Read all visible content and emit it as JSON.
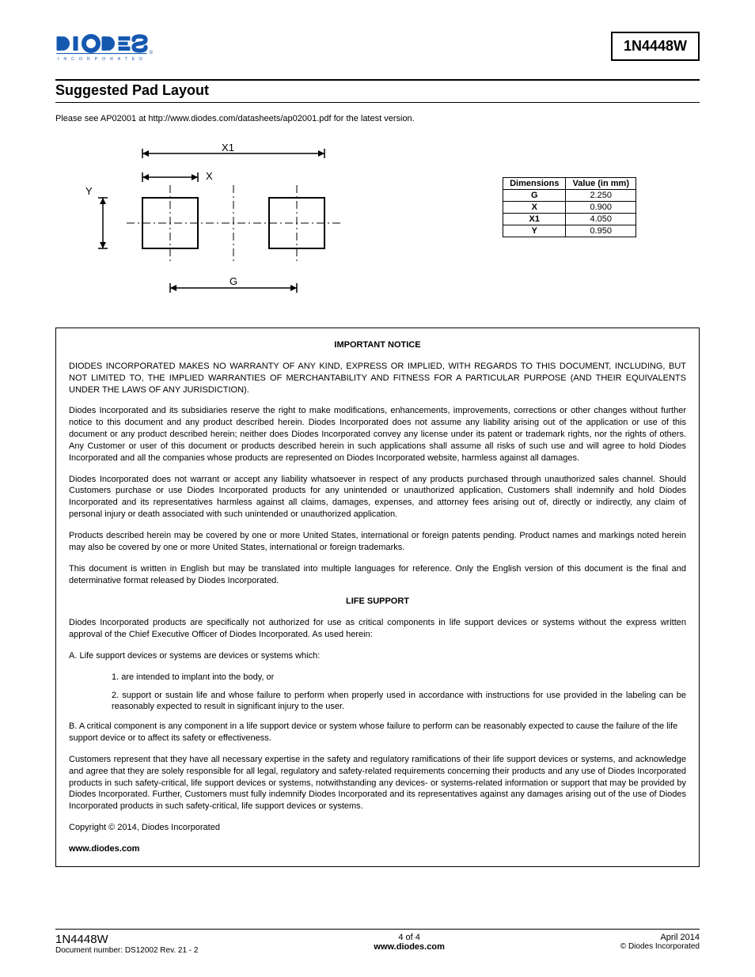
{
  "header": {
    "company": "DIODES",
    "company_sub": "I N C O R P O R A T E D",
    "part_number": "1N4448W"
  },
  "section_title": "Suggested Pad Layout",
  "intro": "Please see AP02001 at http://www.diodes.com/datasheets/ap02001.pdf for the latest version.",
  "diagram_labels": {
    "x1": "X1",
    "x": "X",
    "y": "Y",
    "g": "G"
  },
  "dim_table": {
    "head_dim": "Dimensions",
    "head_val": "Value (in mm)",
    "rows": [
      {
        "dim": "G",
        "val": "2.250"
      },
      {
        "dim": "X",
        "val": "0.900"
      },
      {
        "dim": "X1",
        "val": "4.050"
      },
      {
        "dim": "Y",
        "val": "0.950"
      }
    ]
  },
  "notice": {
    "title": "IMPORTANT NOTICE",
    "p1": "DIODES INCORPORATED MAKES NO WARRANTY OF ANY KIND, EXPRESS OR IMPLIED, WITH REGARDS TO THIS DOCUMENT, INCLUDING, BUT NOT LIMITED TO, THE IMPLIED WARRANTIES OF MERCHANTABILITY AND FITNESS FOR A PARTICULAR PURPOSE (AND THEIR EQUIVALENTS UNDER THE LAWS OF ANY JURISDICTION).",
    "p2": "Diodes Incorporated and its subsidiaries reserve the right to make modifications, enhancements, improvements, corrections or other changes without further notice to this document and any product described herein. Diodes Incorporated does not assume any liability arising out of the application or use of this document or any product described herein; neither does Diodes Incorporated convey any license under its patent or trademark rights, nor the rights of others.  Any Customer or user of this document or products described herein in such applications shall assume all risks of such use and will agree to hold Diodes Incorporated and all the companies whose products are represented on Diodes Incorporated website, harmless against all damages.",
    "p3": "Diodes Incorporated does not warrant or accept any liability whatsoever in respect of any products purchased through unauthorized sales channel. Should Customers purchase or use Diodes Incorporated products for any unintended or unauthorized application, Customers shall indemnify and hold Diodes Incorporated and its representatives harmless against all claims, damages, expenses, and attorney fees arising out of, directly or indirectly, any claim of personal injury or death associated with such unintended or unauthorized application.",
    "p4": "Products described herein may be covered by one or more United States, international or foreign patents pending.  Product names and markings noted herein may also be covered by one or more United States, international or foreign trademarks.",
    "p5": "This document is written in English but may be translated into multiple languages for reference.  Only the English version of this document is the final and determinative format released by Diodes Incorporated.",
    "life_title": "LIFE SUPPORT",
    "life_p1": "Diodes Incorporated products are specifically not authorized for use as critical components in life support devices or systems without the express written approval of the Chief Executive Officer of Diodes Incorporated. As used herein:",
    "life_a": "A.   Life support devices or systems are devices or systems which:",
    "life_a1": "1. are intended to implant into the body, or",
    "life_a2": "2. support or sustain life and whose failure to perform when properly used in accordance with instructions for use provided in the labeling can be reasonably expected to result in significant injury to the user.",
    "life_b": "B.   A critical component is any component in a life support device or system whose failure to perform can be reasonably expected to cause the failure of the life support device or to affect its safety or effectiveness.",
    "customers": "Customers represent that they have all necessary expertise in the safety and regulatory ramifications of their life support devices or systems, and acknowledge and agree that they are solely responsible for all legal, regulatory and safety-related requirements concerning their products and any use of Diodes Incorporated products in such safety-critical, life support devices or systems, notwithstanding any devices- or systems-related information or support that may be provided by Diodes Incorporated.  Further, Customers must fully indemnify Diodes Incorporated and its representatives against any damages arising out of the use of Diodes Incorporated products in such safety-critical, life support devices or systems.",
    "copyright": "Copyright © 2014, Diodes Incorporated",
    "url": "www.diodes.com"
  },
  "footer": {
    "product": "1N4448W",
    "docnum": "Document number: DS12002 Rev. 21 - 2",
    "pagenum": "4 of 4",
    "website": "www.diodes.com",
    "date": "April 2014",
    "copy": "© Diodes Incorporated"
  }
}
